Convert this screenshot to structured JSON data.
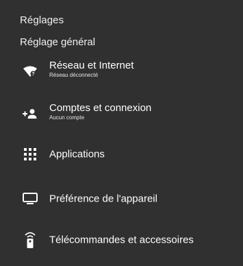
{
  "header": {
    "title": "Réglages",
    "section": "Réglage général"
  },
  "items": [
    {
      "label": "Réseau et Internet",
      "sublabel": "Réseau déconnecté",
      "icon": "wifi-off-icon"
    },
    {
      "label": "Comptes et connexion",
      "sublabel": "Aucun compte",
      "icon": "add-account-icon"
    },
    {
      "label": "Applications",
      "icon": "apps-grid-icon"
    },
    {
      "label": "Préférence de l'appareil",
      "icon": "tv-icon"
    },
    {
      "label": "Télécommandes et accessoires",
      "icon": "remote-icon"
    }
  ],
  "colors": {
    "background": "#303030",
    "text": "#ffffff"
  }
}
